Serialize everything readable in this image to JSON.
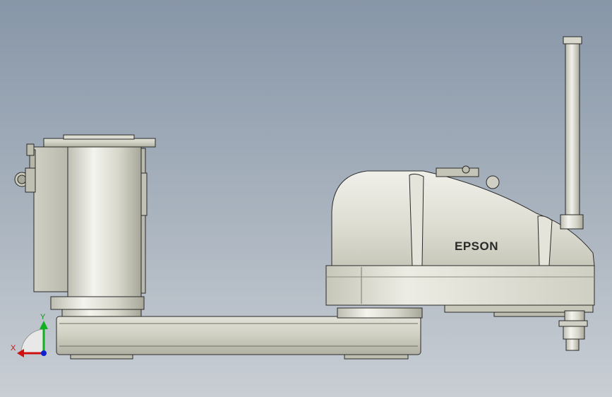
{
  "model": {
    "brand_label": "EPSON"
  },
  "triad": {
    "x_label": "X",
    "y_label": "Y",
    "x_color": "#d01010",
    "y_color": "#10b020",
    "z_color": "#1020d0"
  },
  "colors": {
    "background_top": "#8796a8",
    "background_bottom": "#c9ced4",
    "metal_light": "#f0f0e8",
    "metal_mid": "#d8d8cc",
    "metal_dark": "#a9a99c",
    "outline": "#2a2a2a"
  }
}
